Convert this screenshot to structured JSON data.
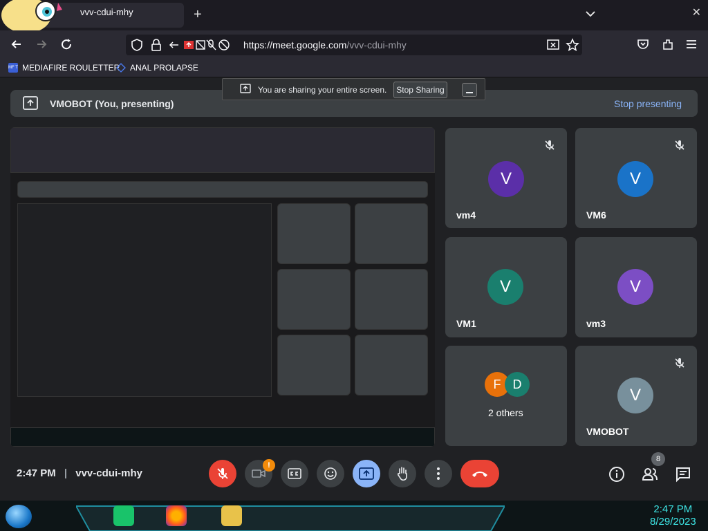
{
  "browser": {
    "tab_title": "vvv-cdui-mhy",
    "url_host": "https://meet.google.com",
    "url_path": "/vvv-cdui-mhy",
    "bookmarks": [
      "MEDIAFIRE ROULETTER",
      "ANAL PROLAPSE"
    ],
    "bookmark_icon_text": "MF T"
  },
  "share_popup": {
    "text": "You are sharing your entire screen.",
    "stop_label": "Stop Sharing"
  },
  "presenting_bar": {
    "title": "VMOBOT (You, presenting)",
    "stop_label": "Stop presenting"
  },
  "participants": [
    {
      "name": "vm4",
      "initial": "V",
      "color": "#5b2fa8",
      "muted": true
    },
    {
      "name": "VM6",
      "initial": "V",
      "color": "#1a73c8",
      "muted": true
    },
    {
      "name": "VM1",
      "initial": "V",
      "color": "#1a7f6e",
      "muted": false
    },
    {
      "name": "vm3",
      "initial": "V",
      "color": "#7c4ec4",
      "muted": false
    },
    {
      "name": "2 others",
      "initials": [
        "F",
        "D"
      ],
      "colors": [
        "#e8710a",
        "#1a7f6e"
      ],
      "muted": false
    },
    {
      "name": "VMOBOT",
      "initial": "V",
      "color": "#78909c",
      "muted": true
    }
  ],
  "meeting": {
    "time": "2:47 PM",
    "code": "vvv-cdui-mhy",
    "people_count": "8",
    "camera_alert": "!"
  },
  "taskbar": {
    "time": "2:47 PM",
    "date": "8/29/2023"
  },
  "colors": {
    "accent_blue": "#8ab4f8",
    "danger_red": "#ea4335",
    "tile_bg": "#3c4043",
    "page_bg": "#202124",
    "taskbar_text": "#3ee6e6"
  }
}
